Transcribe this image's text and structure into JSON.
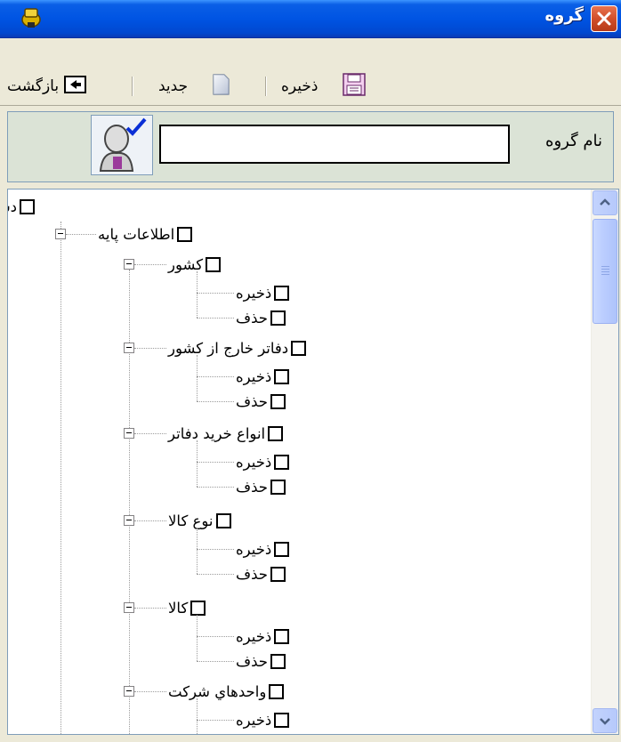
{
  "window": {
    "title": "گروه"
  },
  "toolbar": {
    "back_label": "بازگشت",
    "new_label": "جديد",
    "save_label": "ذخيره"
  },
  "form": {
    "group_name_label": "نام گروه",
    "group_name_value": ""
  },
  "tree": {
    "root": "دسترسي به برنامه",
    "level1": "اطلاعات پايه",
    "items": [
      {
        "label": "كشور",
        "children": [
          "ذخيره",
          "حذف"
        ]
      },
      {
        "label": "دفاتر خارج از كشور",
        "children": [
          "ذخيره",
          "حذف"
        ]
      },
      {
        "label": "انواع خريد دفاتر",
        "children": [
          "ذخيره",
          "حذف"
        ]
      },
      {
        "label": "نوع كالا",
        "children": [
          "ذخيره",
          "حذف"
        ]
      },
      {
        "label": "كالا",
        "children": [
          "ذخيره",
          "حذف"
        ]
      },
      {
        "label": "واحدهاي شركت",
        "children": [
          "ذخيره"
        ]
      }
    ]
  }
}
